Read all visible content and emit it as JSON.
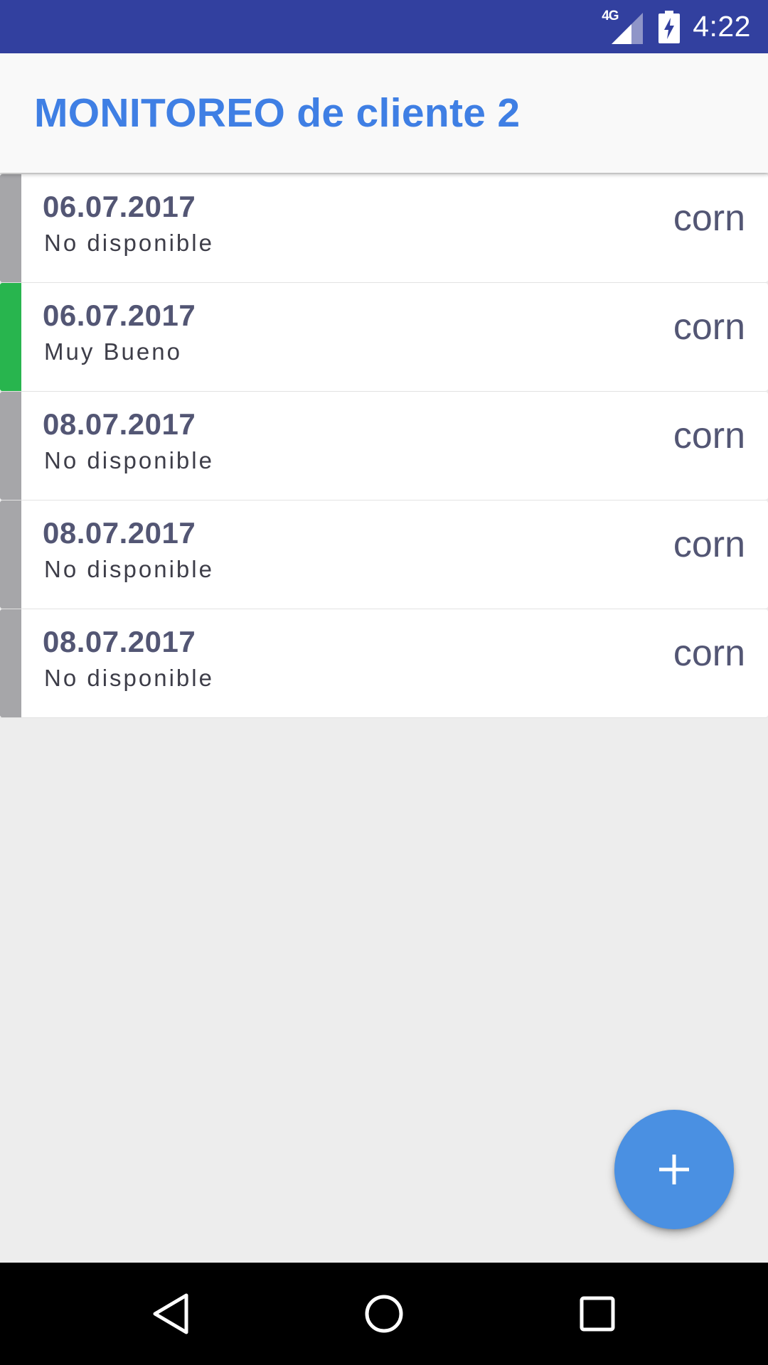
{
  "status_bar": {
    "network": "4G",
    "time": "4:22",
    "icons": [
      "signal-icon",
      "battery-charging-icon"
    ]
  },
  "app_bar": {
    "title": "MONITOREO de cliente 2"
  },
  "records": [
    {
      "date": "06.07.2017",
      "status": "No disponible",
      "crop": "corn",
      "strip_color": "#a6a6a9"
    },
    {
      "date": "06.07.2017",
      "status": "Muy Bueno",
      "crop": "corn",
      "strip_color": "#28b54e"
    },
    {
      "date": "08.07.2017",
      "status": "No disponible",
      "crop": "corn",
      "strip_color": "#a6a6a9"
    },
    {
      "date": "08.07.2017",
      "status": "No disponible",
      "crop": "corn",
      "strip_color": "#a6a6a9"
    },
    {
      "date": "08.07.2017",
      "status": "No disponible",
      "crop": "corn",
      "strip_color": "#a6a6a9"
    }
  ],
  "fab": {
    "icon": "plus-icon",
    "color": "#4a90e2"
  },
  "nav_bar": {
    "icons": [
      "back-icon",
      "home-icon",
      "recents-icon"
    ]
  },
  "colors": {
    "status_bar": "#32409f",
    "title": "#3f7fe4",
    "background": "#ededed"
  }
}
